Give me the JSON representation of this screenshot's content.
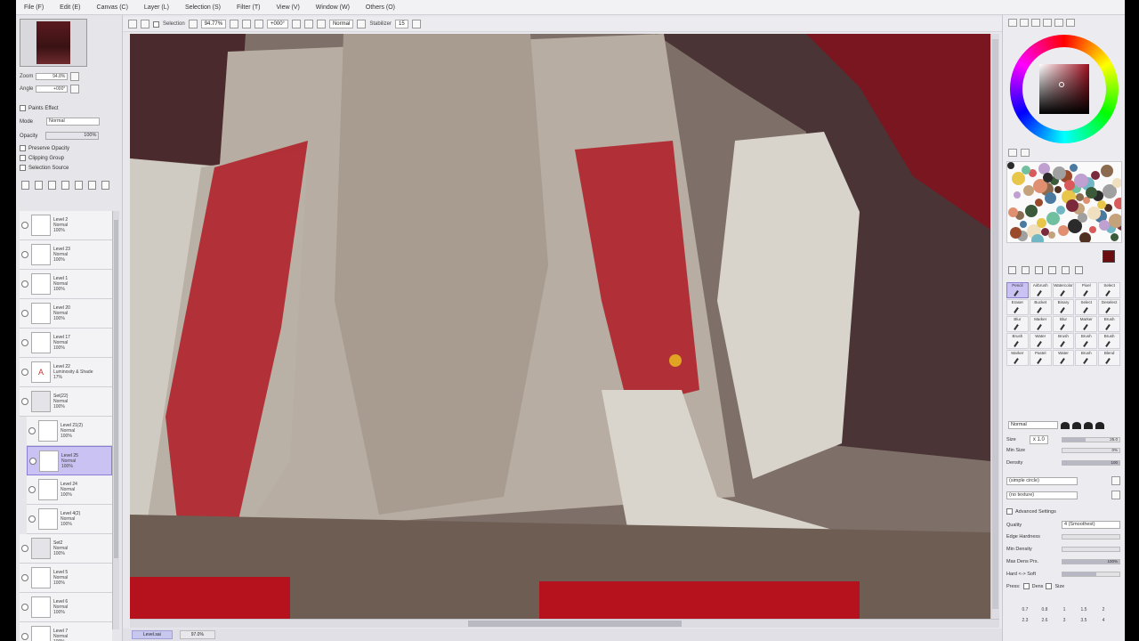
{
  "menu": [
    "File (F)",
    "Edit (E)",
    "Canvas (C)",
    "Layer (L)",
    "Selection (S)",
    "Filter (T)",
    "View (V)",
    "Window (W)",
    "Others (O)"
  ],
  "toolbar": {
    "selection_label": "Selection",
    "zoom_value": "94.77%",
    "rotation_value": "+000°",
    "mode_label": "Normal",
    "stabilizer_label": "Stabilizer",
    "stabilizer_value": "15"
  },
  "navigator": {
    "zoom_label": "Zoom",
    "zoom_value": "94.8%",
    "angle_label": "Angle",
    "angle_value": "+000°"
  },
  "layer_props": {
    "paints_effect": "Paints Effect",
    "blending_label": "Mode",
    "blending_value": "Normal",
    "opacity_label": "Opacity",
    "opacity_value": "100%",
    "preserve_opacity": "Preserve Opacity",
    "clipping_group": "Clipping Group",
    "selection_source": "Selection Source"
  },
  "layers": [
    {
      "name": "Level 2",
      "mode": "Normal",
      "opacity": "100%",
      "indent": false,
      "selected": false,
      "glyph": ""
    },
    {
      "name": "Level 23",
      "mode": "Normal",
      "opacity": "100%",
      "indent": false,
      "selected": false,
      "glyph": ""
    },
    {
      "name": "Level 1",
      "mode": "Normal",
      "opacity": "100%",
      "indent": false,
      "selected": false,
      "glyph": ""
    },
    {
      "name": "Level 20",
      "mode": "Normal",
      "opacity": "100%",
      "indent": false,
      "selected": false,
      "glyph": ""
    },
    {
      "name": "Level 17",
      "mode": "Normal",
      "opacity": "100%",
      "indent": false,
      "selected": false,
      "glyph": ""
    },
    {
      "name": "Level 22",
      "mode": "Luminosity & Shade",
      "opacity": "17%",
      "indent": false,
      "selected": false,
      "glyph": "A"
    },
    {
      "name": "Set(22)",
      "mode": "Normal",
      "opacity": "100%",
      "indent": false,
      "selected": false,
      "glyph": "folder"
    },
    {
      "name": "Level 21(2)",
      "mode": "Normal",
      "opacity": "100%",
      "indent": true,
      "selected": false,
      "glyph": ""
    },
    {
      "name": "Level 25",
      "mode": "Normal",
      "opacity": "100%",
      "indent": true,
      "selected": true,
      "glyph": ""
    },
    {
      "name": "Level 24",
      "mode": "Normal",
      "opacity": "100%",
      "indent": true,
      "selected": false,
      "glyph": ""
    },
    {
      "name": "Level 4(2)",
      "mode": "Normal",
      "opacity": "100%",
      "indent": true,
      "selected": false,
      "glyph": "figure"
    },
    {
      "name": "Set2",
      "mode": "Normal",
      "opacity": "100%",
      "indent": false,
      "selected": false,
      "glyph": "folder"
    },
    {
      "name": "Level 5",
      "mode": "Normal",
      "opacity": "100%",
      "indent": false,
      "selected": false,
      "glyph": ""
    },
    {
      "name": "Level 6",
      "mode": "Normal",
      "opacity": "100%",
      "indent": false,
      "selected": false,
      "glyph": ""
    },
    {
      "name": "Level 7",
      "mode": "Normal",
      "opacity": "100%",
      "indent": false,
      "selected": false,
      "glyph": ""
    }
  ],
  "brushes": [
    "Pencil",
    "Airbrush",
    "Watercolor",
    "Pixel",
    "Select",
    "Eraser",
    "Bucket",
    "Binary",
    "Select",
    "Deselect",
    "Blur",
    "Marker",
    "Blur",
    "Marker",
    "Brush",
    "Brush",
    "Water",
    "Brush",
    "Brush",
    "Brush",
    "Marker",
    "Pastel",
    "Water",
    "Brush",
    "Blend"
  ],
  "brush_panel": {
    "mode_value": "Normal",
    "size_label": "Size",
    "size_value": "x 1.0",
    "size_num": "25.0",
    "min_size_label": "Min Size",
    "min_size_value": "0%",
    "density_label": "Density",
    "density_value": "100",
    "shape_value": "(simple circle)",
    "texture_value": "(no texture)",
    "advanced_label": "Advanced Settings",
    "quality_label": "Quality",
    "quality_value": "4 (Smoothest)",
    "edge_hardness_label": "Edge Hardness",
    "min_density_label": "Min Density",
    "max_dens_prs_label": "Max Dens Prs.",
    "max_dens_prs_value": "100%",
    "hard_soft_label": "Hard <-> Soft",
    "press_label": "Press:",
    "dens_label": "Dens",
    "size_check_label": "Size"
  },
  "size_presets": [
    "0.7",
    "0.8",
    "1",
    "1.5",
    "2",
    "2.3",
    "2.6",
    "3",
    "3.5",
    "4"
  ],
  "status": {
    "tab1": "Level.sai",
    "tab2": "97.0%"
  },
  "colors": {
    "accent_select": "#c9c2f2",
    "main_color": "#6a0c10"
  }
}
